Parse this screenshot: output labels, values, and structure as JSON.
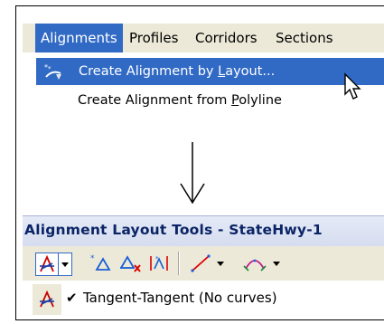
{
  "menubar": {
    "items": [
      {
        "label": "Alignments",
        "active": true
      },
      {
        "label": "Profiles"
      },
      {
        "label": "Corridors"
      },
      {
        "label": "Sections"
      }
    ]
  },
  "dropdown": {
    "items": [
      {
        "label_pre": "Create Alignment by ",
        "label_mnemonic": "L",
        "label_post": "ayout...",
        "icon": "create-alignment-icon",
        "highlighted": true
      },
      {
        "label_pre": "Create Alignment from ",
        "label_mnemonic": "P",
        "label_post": "olyline",
        "highlighted": false
      }
    ]
  },
  "toolbar": {
    "title": "Alignment Layout Tools - StateHwy-1",
    "buttons": [
      {
        "icon": "tangent-tangent-icon"
      },
      {
        "icon": "dropdown-arrow-icon"
      },
      {
        "icon": "insert-pi-icon"
      },
      {
        "icon": "delete-pi-icon"
      },
      {
        "icon": "break-apart-pi-icon"
      },
      {
        "icon": "line-tools-icon"
      },
      {
        "icon": "curve-tools-icon"
      }
    ],
    "dropdown_item": {
      "label": "Tangent-Tangent (No curves)",
      "checked": true,
      "icon": "tangent-tangent-icon"
    }
  },
  "colors": {
    "highlight": "#316ac5",
    "menubar": "#ece9d8",
    "title_text": "#0a2466"
  }
}
